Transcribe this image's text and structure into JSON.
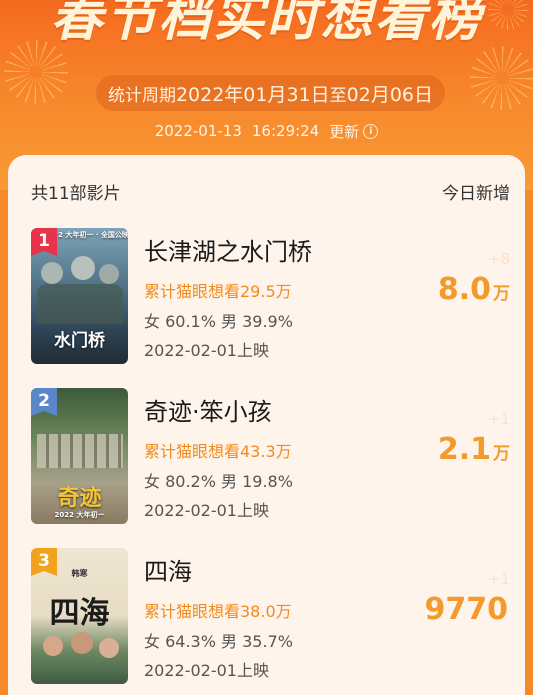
{
  "header": {
    "title": "春节档实时想看榜",
    "period_prefix": "统计周期",
    "period_start": "2022年01月31日",
    "period_to": "至",
    "period_end": "02月06日",
    "update_date": "2022-01-13",
    "update_time": "16:29:24",
    "update_label": "更新"
  },
  "colors": {
    "accent_orange": "#f39a2a",
    "rank1": "#e8344b",
    "rank2": "#5b87c9",
    "rank3": "#f2a21c"
  },
  "list": {
    "count_label": "共11部影片",
    "today_label": "今日新增"
  },
  "movies": [
    {
      "rank": "1",
      "title": "长津湖之水门桥",
      "want": "累计猫眼想看29.5万",
      "gender": "女 60.1% 男 39.9%",
      "release": "2022-02-01上映",
      "delta": "+8",
      "today_value": "8.0",
      "today_unit": "万",
      "poster_top_text": "2 大年初一 · 全国公映",
      "poster_main_text": "水门桥"
    },
    {
      "rank": "2",
      "title": "奇迹·笨小孩",
      "want": "累计猫眼想看43.3万",
      "gender": "女 80.2% 男 19.8%",
      "release": "2022-02-01上映",
      "delta": "+1",
      "today_value": "2.1",
      "today_unit": "万",
      "poster_main_text": "奇迹",
      "poster_bottom_text": "2022 大年初一"
    },
    {
      "rank": "3",
      "title": "四海",
      "want": "累计猫眼想看38.0万",
      "gender": "女 64.3% 男 35.7%",
      "release": "2022-02-01上映",
      "delta": "+1",
      "today_value": "9770",
      "today_unit": "",
      "poster_top_text": "韩寒",
      "poster_main_text": "四海"
    }
  ]
}
